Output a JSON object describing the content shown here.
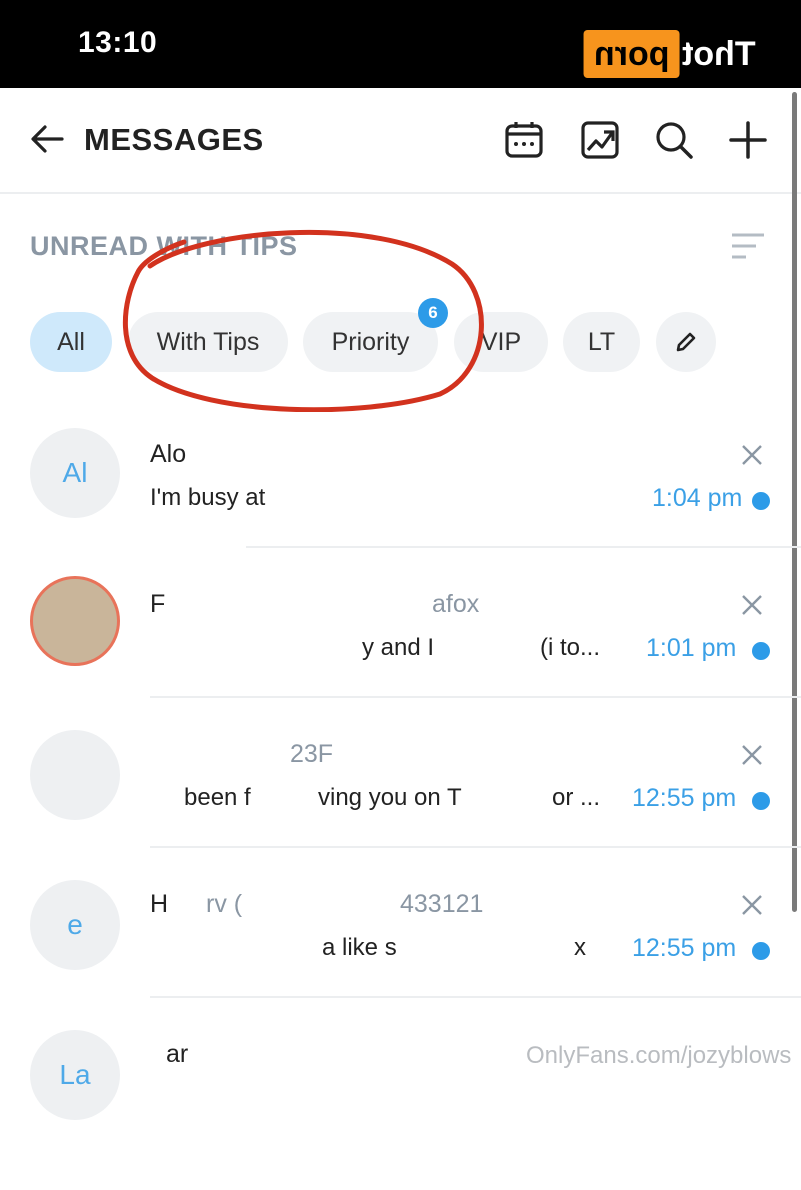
{
  "status_bar": {
    "time": "13:10"
  },
  "watermark": {
    "logo_text": "porn",
    "logo_prefix": "Thot",
    "footer": "OnlyFans.com/jozyblows"
  },
  "header": {
    "title": "MESSAGES",
    "icons": [
      "back-arrow-icon",
      "calendar-icon",
      "chart-icon",
      "search-icon",
      "plus-icon"
    ]
  },
  "section": {
    "title": "UNREAD WITH TIPS",
    "sort_icon": "sort-lines-icon"
  },
  "filters": [
    {
      "label": "All",
      "active": true
    },
    {
      "label": "With Tips",
      "active": false
    },
    {
      "label": "Priority",
      "active": false,
      "badge": "6"
    },
    {
      "label": "VIP",
      "active": false
    },
    {
      "label": "LT",
      "active": false
    }
  ],
  "messages": [
    {
      "avatar": "Al",
      "name": "Alo",
      "handle": "",
      "preview": "I'm busy at",
      "preview_tail": "",
      "time": "1:04 pm",
      "unread": true
    },
    {
      "avatar": "",
      "name": "F",
      "handle": "afox",
      "preview": "y and I",
      "preview_tail": "(i to...",
      "time": "1:01 pm",
      "unread": true
    },
    {
      "avatar": "",
      "name": "",
      "handle": "23F",
      "preview": "been f",
      "preview_tail": "ving you on T",
      "preview_tail2": "or ...",
      "time": "12:55 pm",
      "unread": true
    },
    {
      "avatar": "e",
      "name": "H",
      "handle": "rv (",
      "handle2": "433121",
      "preview": "a like s",
      "preview_tail": "x",
      "time": "12:55 pm",
      "unread": true
    },
    {
      "avatar": "La",
      "name": "ar",
      "handle": "",
      "preview": "",
      "preview_tail": "",
      "time": "",
      "unread": false
    }
  ],
  "colors": {
    "accent": "#2d9be8",
    "time": "#3ba0e6",
    "chip_bg": "#f0f2f4",
    "chip_active": "#cfe9fb",
    "annotation": "#d2321e"
  }
}
